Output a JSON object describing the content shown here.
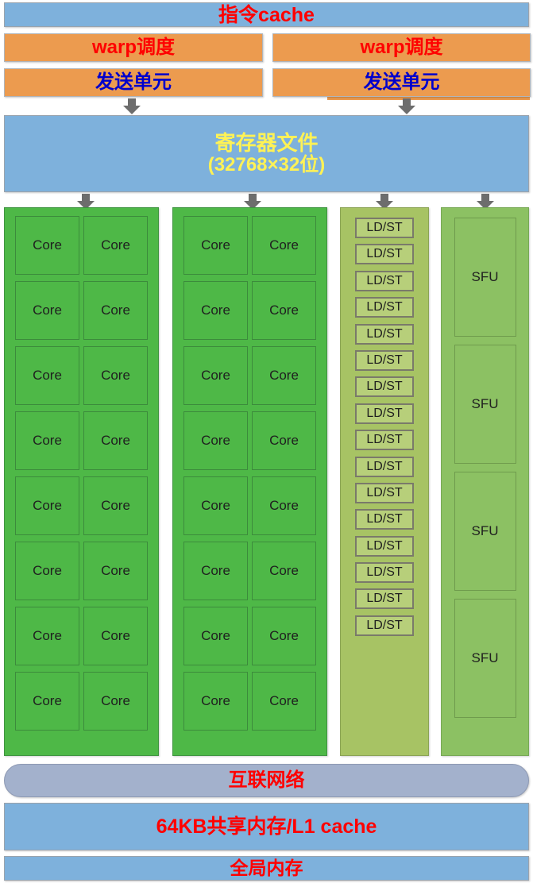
{
  "diagram": {
    "title": "GPU Streaming Multiprocessor architecture",
    "colors": {
      "instruction_cache_fill": "#7EB1DC",
      "warp_scheduler_fill": "#EC9B4F",
      "dispatch_unit_fill": "#EC9B4F",
      "register_file_fill": "#7EB1DC",
      "core_group_fill": "#4EB847",
      "ldst_group_fill": "#A7C364",
      "sfu_group_fill": "#8CC163",
      "interconnect_fill": "#A3B1CC",
      "shared_memory_fill": "#7EB1DC",
      "global_memory_fill": "#7EB1DC",
      "red_text": "#FF0000",
      "blue_text": "#0000CC",
      "yellow_text": "#FFF255",
      "arrow_gray": "#6D6D6D"
    }
  },
  "instruction_cache": {
    "label": "指令cache"
  },
  "warp_schedulers": [
    {
      "label": "warp调度"
    },
    {
      "label": "warp调度"
    }
  ],
  "dispatch_units": [
    {
      "label": "发送单元"
    },
    {
      "label": "发送单元"
    }
  ],
  "register_file": {
    "label": "寄存器文件",
    "capacity": "(32768×32位)"
  },
  "execution_columns": [
    {
      "type": "core",
      "unit_label": "Core",
      "rows": 8,
      "columns": 2,
      "count": 16
    },
    {
      "type": "core",
      "unit_label": "Core",
      "rows": 8,
      "columns": 2,
      "count": 16
    },
    {
      "type": "ldst",
      "unit_label": "LD/ST",
      "count": 16
    },
    {
      "type": "sfu",
      "unit_label": "SFU",
      "count": 4
    }
  ],
  "interconnect": {
    "label": "互联网络"
  },
  "shared_memory": {
    "label": "64KB共享内存/L1 cache"
  },
  "global_memory": {
    "label": "全局内存"
  },
  "arrows": {
    "icon": "arrow-down-icon",
    "dispatch_to_register": 2,
    "register_to_columns": 4
  }
}
